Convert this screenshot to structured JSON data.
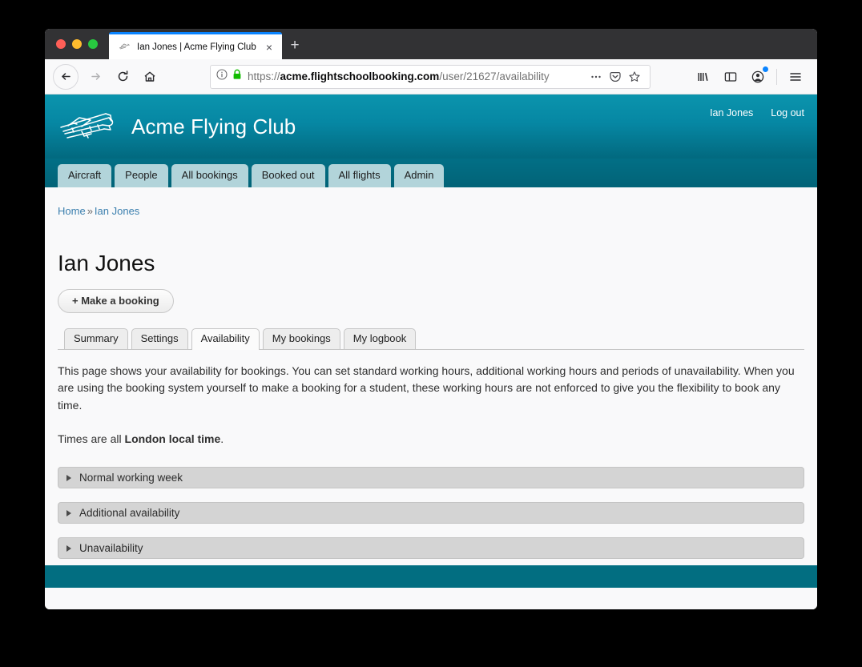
{
  "browser": {
    "tab": {
      "title": "Ian Jones | Acme Flying Club",
      "favicon_name": "plane-favicon",
      "close_label": "×"
    },
    "new_tab_label": "+",
    "nav": {
      "back_label": "←",
      "forward_label": "→",
      "reload_label": "↻",
      "home_label": "⌂"
    },
    "url": {
      "scheme": "https://",
      "host": "acme.flightschoolbooking.com",
      "path": "/user/21627/availability",
      "full": "https://acme.flightschoolbooking.com/user/21627/availability",
      "info_icon": "info-icon",
      "lock_icon": "padlock-icon",
      "page_actions_label": "•••",
      "pocket_icon": "pocket-icon",
      "bookmark_icon": "star-icon"
    },
    "toolbar_right": {
      "library_icon": "library-icon",
      "sidebar_icon": "sidebar-icon",
      "account_icon": "account-icon",
      "menu_icon": "hamburger-menu-icon"
    }
  },
  "site": {
    "brand": "Acme Flying Club",
    "logo_name": "aeroplane-logo",
    "header_links": [
      {
        "label": "Ian Jones",
        "name": "user-name-link"
      },
      {
        "label": "Log out",
        "name": "log-out-link"
      }
    ],
    "nav_tabs": [
      "Aircraft",
      "People",
      "All bookings",
      "Booked out",
      "All flights",
      "Admin"
    ]
  },
  "page": {
    "breadcrumb": {
      "home": "Home",
      "separator": "»",
      "current": "Ian Jones"
    },
    "title": "Ian Jones",
    "make_booking_label": "+ Make a booking",
    "inner_tabs": [
      {
        "label": "Summary",
        "active": false
      },
      {
        "label": "Settings",
        "active": false
      },
      {
        "label": "Availability",
        "active": true
      },
      {
        "label": "My bookings",
        "active": false
      },
      {
        "label": "My logbook",
        "active": false
      }
    ],
    "intro_paragraph": "This page shows your availability for bookings. You can set standard working hours, additional working hours and periods of unavailability. When you are using the booking system yourself to make a booking for a student, these working hours are not enforced to give you the flexibility to book any time.",
    "times_prefix": "Times are all ",
    "times_bold": "London local time",
    "times_suffix": ".",
    "accordion": [
      {
        "label": "Normal working week",
        "expanded": false
      },
      {
        "label": "Additional availability",
        "expanded": false
      },
      {
        "label": "Unavailability",
        "expanded": false
      }
    ]
  },
  "colors": {
    "brand_teal_top": "#0b94ad",
    "brand_teal_bottom": "#02697f",
    "nav_tab_bg": "#b2d4da",
    "footer": "#026e81",
    "link_blue": "#3b7fae",
    "accent_blue": "#0a84ff"
  }
}
